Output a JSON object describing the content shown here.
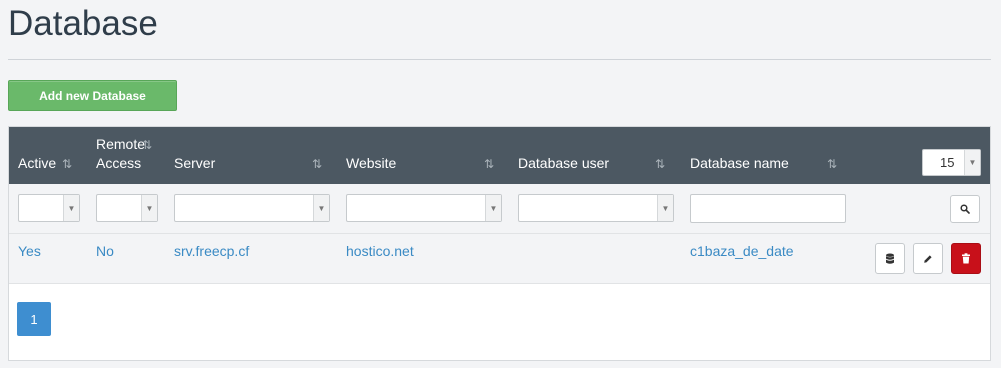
{
  "page": {
    "title": "Database"
  },
  "toolbar": {
    "add_label": "Add new Database"
  },
  "table": {
    "columns": [
      {
        "label": "Active",
        "sort_icon": "⇅"
      },
      {
        "label": "Remote",
        "label2": "Access",
        "sort_icon": "⇅"
      },
      {
        "label": "Server",
        "sort_icon": "⇅"
      },
      {
        "label": "Website",
        "sort_icon": "⇅"
      },
      {
        "label": "Database user",
        "sort_icon": "⇅"
      },
      {
        "label": "Database name",
        "sort_icon": "⇅"
      }
    ],
    "per_page": "15",
    "rows": [
      {
        "active": "Yes",
        "remote_access": "No",
        "server": "srv.freecp.cf",
        "website": "hostico.net",
        "database_user": "",
        "database_name": "c1baza_de_date"
      }
    ],
    "row_actions": [
      "database-icon",
      "pencil-icon",
      "trash-icon"
    ]
  },
  "pagination": {
    "current_page": "1"
  },
  "colors": {
    "header_bg": "#4c5862",
    "add_button": "#6ab96a",
    "link": "#3a8ac4",
    "delete": "#c8101a",
    "pager": "#3e8ed0"
  }
}
